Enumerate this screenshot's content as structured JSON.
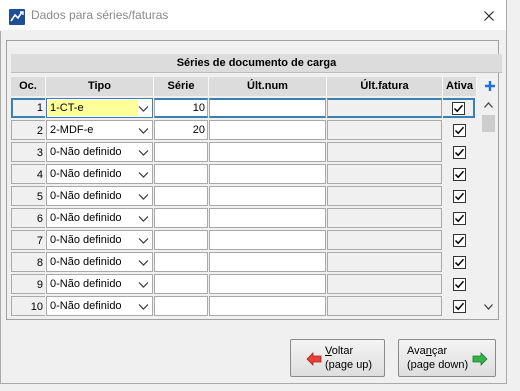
{
  "window": {
    "title": "Dados para séries/faturas",
    "icon": "app-logo-icon",
    "close_icon": "close-icon"
  },
  "grid": {
    "title": "Séries de documento de carga",
    "columns": {
      "oc": "Oc.",
      "tipo": "Tipo",
      "serie": "Série",
      "ultnum": "Últ.num",
      "ultfatura": "Últ.fatura",
      "ativa": "Ativa"
    },
    "add_icon": "plus-icon",
    "rows": [
      {
        "oc": "1",
        "tipo": "1-CT-e",
        "serie": "10",
        "ultnum": "",
        "ultfatura": "",
        "ativa": true
      },
      {
        "oc": "2",
        "tipo": "2-MDF-e",
        "serie": "20",
        "ultnum": "",
        "ultfatura": "",
        "ativa": true
      },
      {
        "oc": "3",
        "tipo": "0-Não definido",
        "serie": "",
        "ultnum": "",
        "ultfatura": "",
        "ativa": true
      },
      {
        "oc": "4",
        "tipo": "0-Não definido",
        "serie": "",
        "ultnum": "",
        "ultfatura": "",
        "ativa": true
      },
      {
        "oc": "5",
        "tipo": "0-Não definido",
        "serie": "",
        "ultnum": "",
        "ultfatura": "",
        "ativa": true
      },
      {
        "oc": "6",
        "tipo": "0-Não definido",
        "serie": "",
        "ultnum": "",
        "ultfatura": "",
        "ativa": true
      },
      {
        "oc": "7",
        "tipo": "0-Não definido",
        "serie": "",
        "ultnum": "",
        "ultfatura": "",
        "ativa": true
      },
      {
        "oc": "8",
        "tipo": "0-Não definido",
        "serie": "",
        "ultnum": "",
        "ultfatura": "",
        "ativa": true
      },
      {
        "oc": "9",
        "tipo": "0-Não definido",
        "serie": "",
        "ultnum": "",
        "ultfatura": "",
        "ativa": true
      },
      {
        "oc": "10",
        "tipo": "0-Não definido",
        "serie": "",
        "ultnum": "",
        "ultfatura": "",
        "ativa": true
      }
    ]
  },
  "buttons": {
    "back": {
      "line1_u": "V",
      "line1_rest": "oltar",
      "line2": "(page up)",
      "icon": "arrow-left-icon"
    },
    "next": {
      "line1_pre": "Ava",
      "line1_u": "n",
      "line1_rest": "çar",
      "line2": "(page down)",
      "icon": "arrow-right-icon"
    }
  },
  "colors": {
    "selected_cell_highlight": "#ffff99",
    "selection_border": "#3c7fb1",
    "plus_icon": "#1e6fd9",
    "back_arrow": "#e8403a",
    "next_arrow": "#36b04a"
  }
}
